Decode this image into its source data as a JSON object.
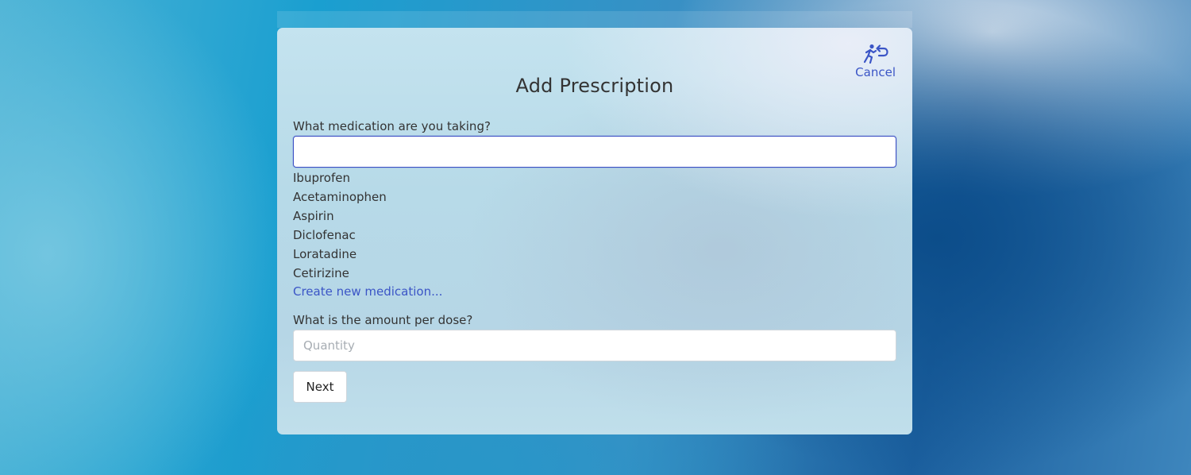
{
  "modal": {
    "title": "Add Prescription",
    "cancel_label": "Cancel",
    "cancel_icon": "running-person-return-icon"
  },
  "medication": {
    "question": "What medication are you taking?",
    "value": "",
    "suggestions": [
      "Ibuprofen",
      "Acetaminophen",
      "Aspirin",
      "Diclofenac",
      "Loratadine",
      "Cetirizine"
    ],
    "create_link": "Create new medication..."
  },
  "dose": {
    "question": "What is the amount per dose?",
    "placeholder": "Quantity",
    "value": ""
  },
  "actions": {
    "next_label": "Next"
  },
  "colors": {
    "accent": "#3b55c6",
    "text": "#333333"
  }
}
